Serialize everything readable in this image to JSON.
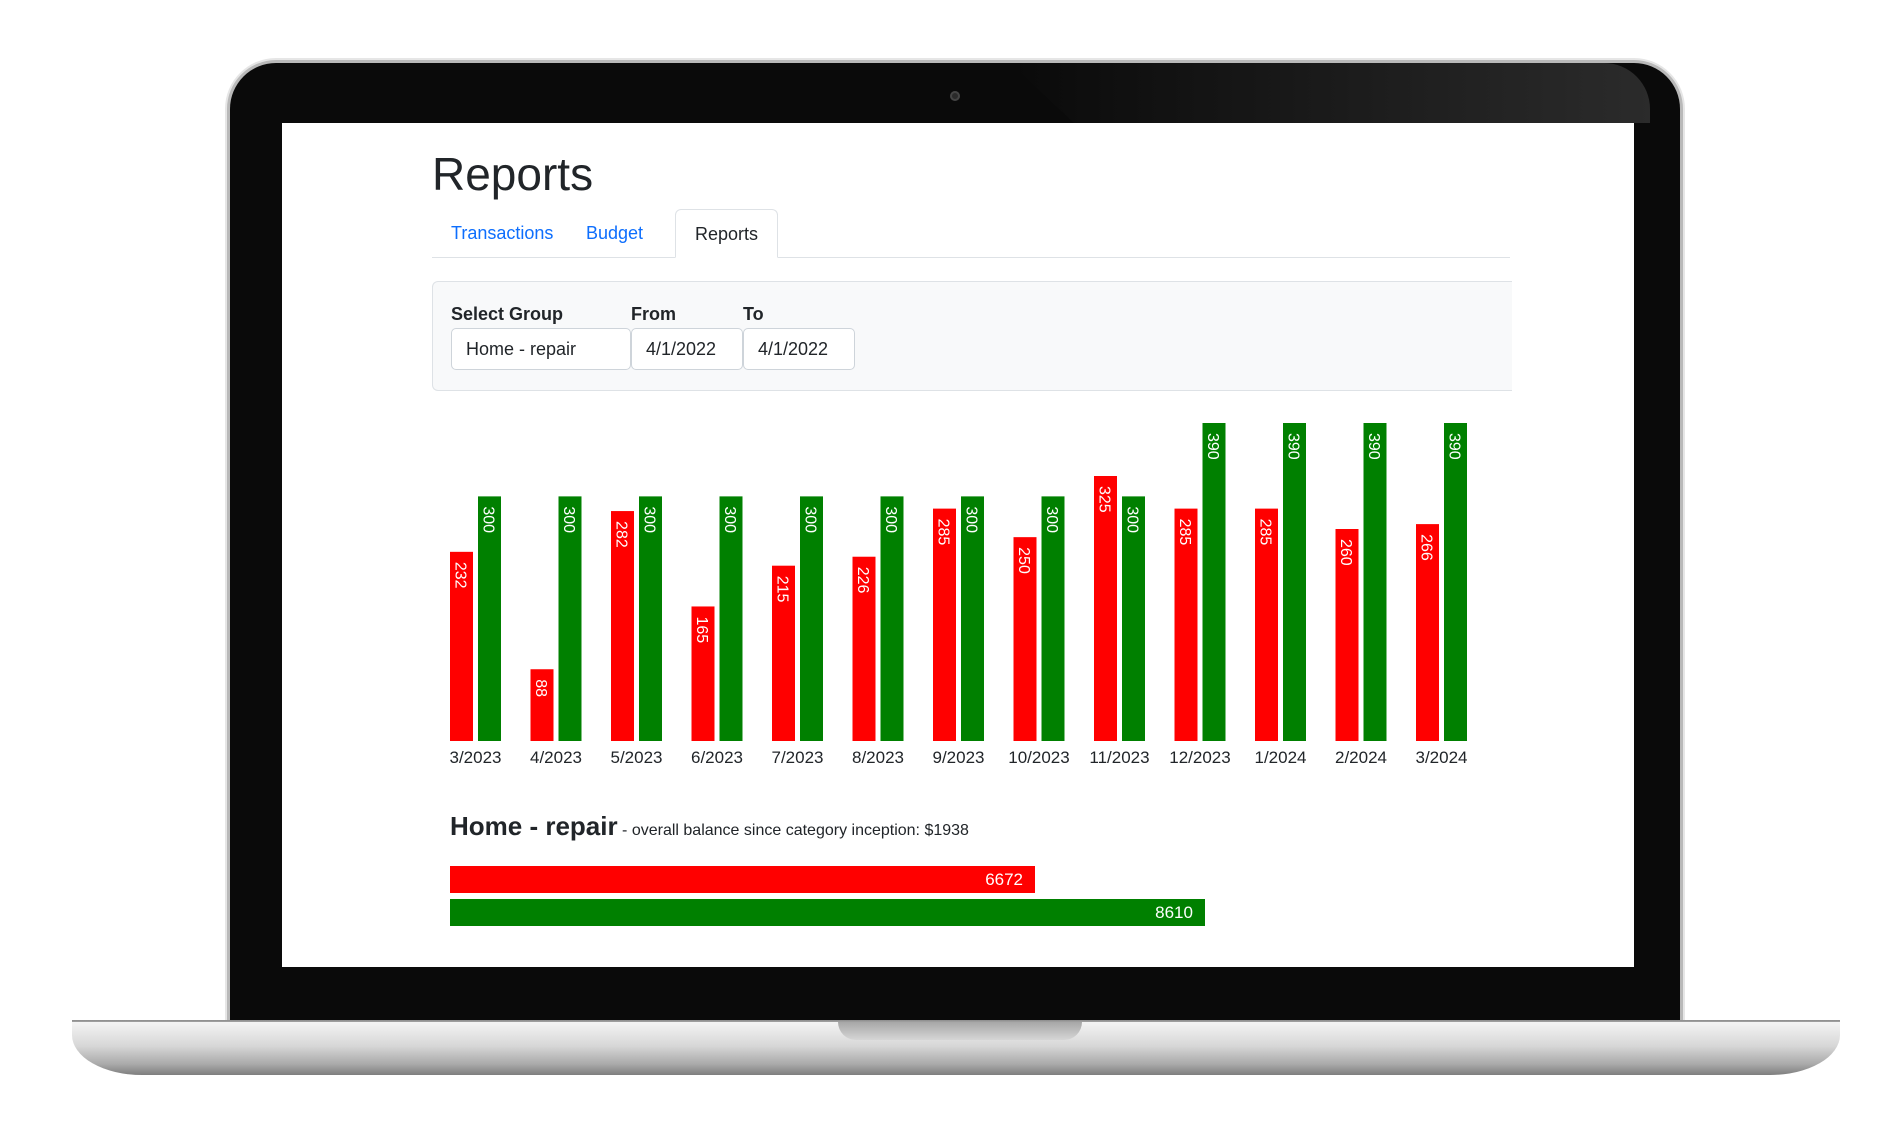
{
  "page": {
    "title": "Reports"
  },
  "tabs": [
    {
      "label": "Transactions",
      "active": false
    },
    {
      "label": "Budget",
      "active": false
    },
    {
      "label": "Reports",
      "active": true
    }
  ],
  "filters": {
    "group_label": "Select Group",
    "group_value": "Home - repair",
    "from_label": "From",
    "from_value": "4/1/2022",
    "to_label": "To",
    "to_value": "4/1/2022"
  },
  "colors": {
    "spent": "#ff0000",
    "budget": "#008000",
    "link": "#0d6efd"
  },
  "chart_data": {
    "type": "bar",
    "title": "",
    "xlabel": "",
    "ylabel": "",
    "categories": [
      "3/2023",
      "4/2023",
      "5/2023",
      "6/2023",
      "7/2023",
      "8/2023",
      "9/2023",
      "10/2023",
      "11/2023",
      "12/2023",
      "1/2024",
      "2/2024",
      "3/2024"
    ],
    "series": [
      {
        "color": "#ff0000",
        "values": [
          232,
          88,
          282,
          165,
          215,
          226,
          285,
          250,
          325,
          285,
          285,
          260,
          266
        ]
      },
      {
        "color": "#008000",
        "values": [
          300,
          300,
          300,
          300,
          300,
          300,
          300,
          300,
          300,
          390,
          390,
          390,
          390
        ]
      }
    ],
    "ylim": [
      0,
      390
    ],
    "grid": false,
    "legend": "none"
  },
  "summary": {
    "group_name": "Home - repair",
    "text": " - overall balance since category inception: $1938",
    "spent_total": 6672,
    "budget_total": 8610
  }
}
